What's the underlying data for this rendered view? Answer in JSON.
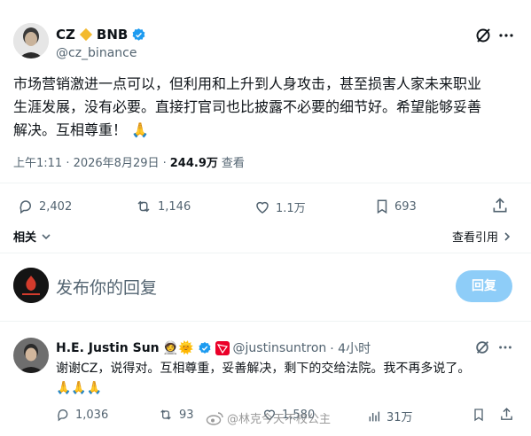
{
  "tweet": {
    "author_name": "CZ",
    "author_name2": "BNB",
    "handle": "@cz_binance",
    "body_lines": [
      "市场营销激进一点可以，但利用和上升到人身攻击，甚至损害人家未来职业",
      "生涯发展，没有必要。直接打官司也比披露不必要的细节好。希望能够妥善",
      "解决。互相尊重！"
    ],
    "body_emoji": "🙏",
    "timestamp": "上午1:11 · 2026年8月29日 ·",
    "views": "244.9万",
    "views_label": "查看",
    "stats": {
      "replies": "2,402",
      "retweets": "1,146",
      "likes": "1.1万",
      "bookmarks": "693"
    },
    "related_label": "相关",
    "view_quotes_label": "查看引用"
  },
  "reply_box": {
    "placeholder": "发布你的回复",
    "button_label": "回复"
  },
  "reply": {
    "author_name": "H.E. Justin Sun",
    "emojis": "🧑‍🚀🌞",
    "handle": "@justinsuntron",
    "time": "· 4小时",
    "body": "谢谢CZ，说得对。互相尊重，妥善解决，剩下的交给法院。我不再多说了。",
    "emoji_line": "🙏🙏🙏",
    "stats": {
      "replies": "1,036",
      "retweets": "93",
      "likes": "1,580",
      "views": "31万"
    }
  },
  "watermark": "@林克今天不校公主",
  "colors": {
    "verified": "#1d9bf0",
    "bnb": "#f3ba2f",
    "reply_button": "#8ecdf8",
    "muted": "#536471"
  }
}
